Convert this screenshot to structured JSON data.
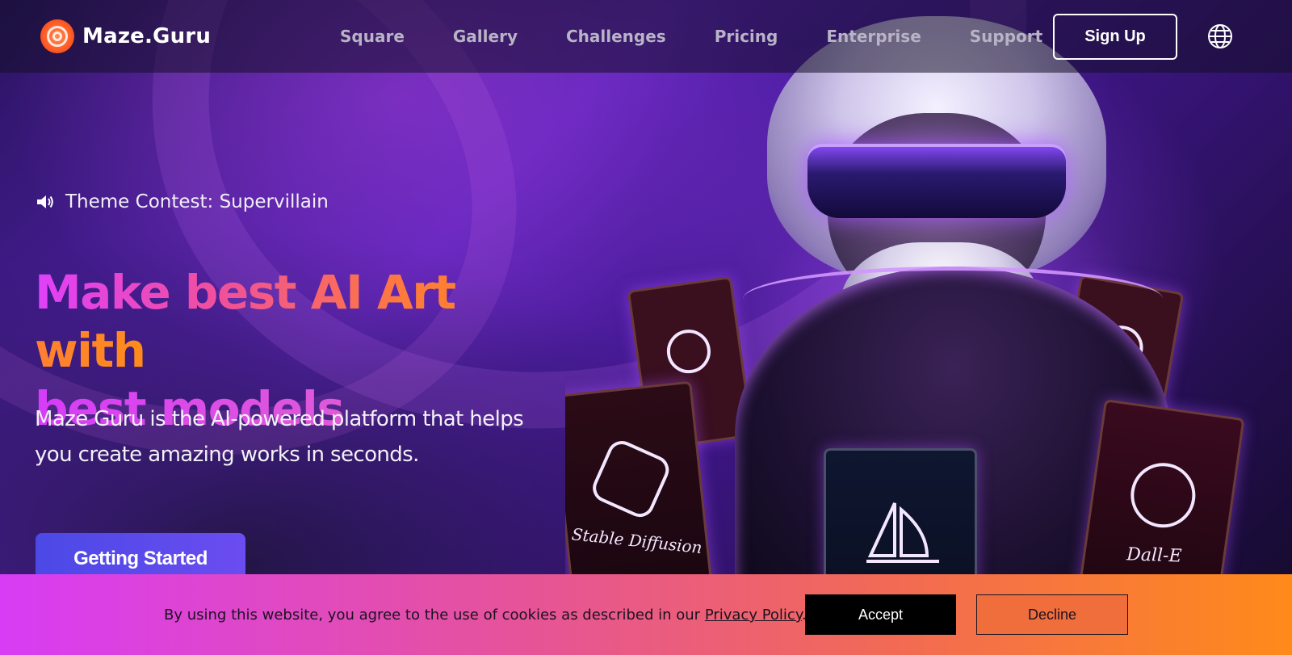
{
  "brand": {
    "name": "Maze.Guru",
    "logo_icon": "maze-logo-icon",
    "color": "#ff5a24"
  },
  "nav": {
    "links": [
      {
        "label": "Square"
      },
      {
        "label": "Gallery"
      },
      {
        "label": "Challenges"
      },
      {
        "label": "Pricing"
      },
      {
        "label": "Enterprise"
      },
      {
        "label": "Support"
      }
    ],
    "signup_label": "Sign Up",
    "language_icon": "globe-icon"
  },
  "hero": {
    "announcement": "Theme Contest: Supervillain",
    "announcement_icon": "speaker-icon",
    "headline_line1": "Make best AI Art with",
    "headline_line2": "best models",
    "subtext": "Maze Guru is the AI-powered platform that helps you create amazing works in seconds.",
    "cta_label": "Getting Started",
    "gradient_colors": [
      "#e040fb",
      "#f0509a",
      "#ff7a3c",
      "#ff8c1a"
    ]
  },
  "art": {
    "cards": [
      {
        "label": "Dall-E"
      },
      {
        "label": "Stable Diffusion"
      },
      {
        "label": "Midjourney"
      },
      {
        "label": "Dall-E"
      }
    ]
  },
  "cookie": {
    "text": "By using this website, you agree to the use of cookies as described in our",
    "link": "Privacy Policy",
    "period": ".",
    "accept_label": "Accept",
    "decline_label": "Decline"
  }
}
